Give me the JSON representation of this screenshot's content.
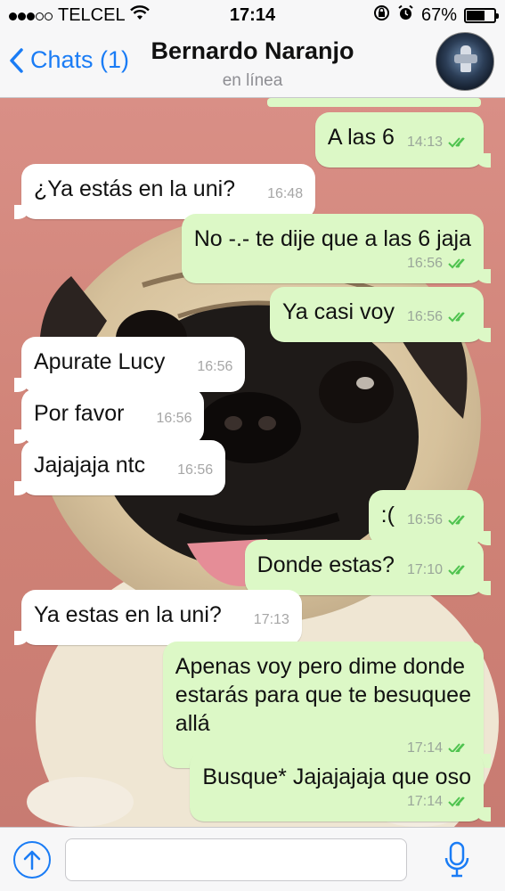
{
  "status_bar": {
    "carrier": "TELCEL",
    "time": "17:14",
    "battery_percent": "67%",
    "battery_level": 0.67,
    "signal_bars": 3,
    "signal_total": 5
  },
  "nav": {
    "back_label": "Chats (1)",
    "contact_name": "Bernardo Naranjo",
    "contact_status": "en línea"
  },
  "messages": [
    {
      "dir": "out",
      "text": "A las 6",
      "time": "14:13",
      "read": true
    },
    {
      "dir": "in",
      "text": "¿Ya estás en la uni?",
      "time": "16:48"
    },
    {
      "dir": "out",
      "text": "No -.- te dije que a las 6 jaja",
      "time": "16:56",
      "read": true
    },
    {
      "dir": "out",
      "text": "Ya casi voy",
      "time": "16:56",
      "read": true
    },
    {
      "dir": "in",
      "text": "Apurate Lucy",
      "time": "16:56"
    },
    {
      "dir": "in",
      "text": "Por favor",
      "time": "16:56"
    },
    {
      "dir": "in",
      "text": "Jajajaja ntc",
      "time": "16:56"
    },
    {
      "dir": "out",
      "text": ":(",
      "time": "16:56",
      "read": true
    },
    {
      "dir": "out",
      "text": "Donde estas?",
      "time": "17:10",
      "read": true
    },
    {
      "dir": "in",
      "text": "Ya estas en la uni?",
      "time": "17:13"
    },
    {
      "dir": "out",
      "text": "Apenas voy pero dime donde\nestarás para que te besuquee\nallá",
      "time": "17:14",
      "read": true
    },
    {
      "dir": "out",
      "text": "Busque* Jajajajaja que oso",
      "time": "17:14",
      "read": true
    }
  ],
  "input": {
    "value": "",
    "placeholder": ""
  },
  "colors": {
    "accent": "#1a7cf5",
    "outgoing_bubble": "#dcf8c6",
    "incoming_bubble": "#ffffff",
    "read_ticks": "#4fc34f"
  },
  "icons": {
    "back": "chevron-left-icon",
    "wifi": "wifi-icon",
    "rotation_lock": "rotation-lock-icon",
    "alarm": "alarm-icon",
    "battery": "battery-icon",
    "attach": "upload-arrow-icon",
    "mic": "microphone-icon",
    "ticks": "double-check-icon"
  }
}
